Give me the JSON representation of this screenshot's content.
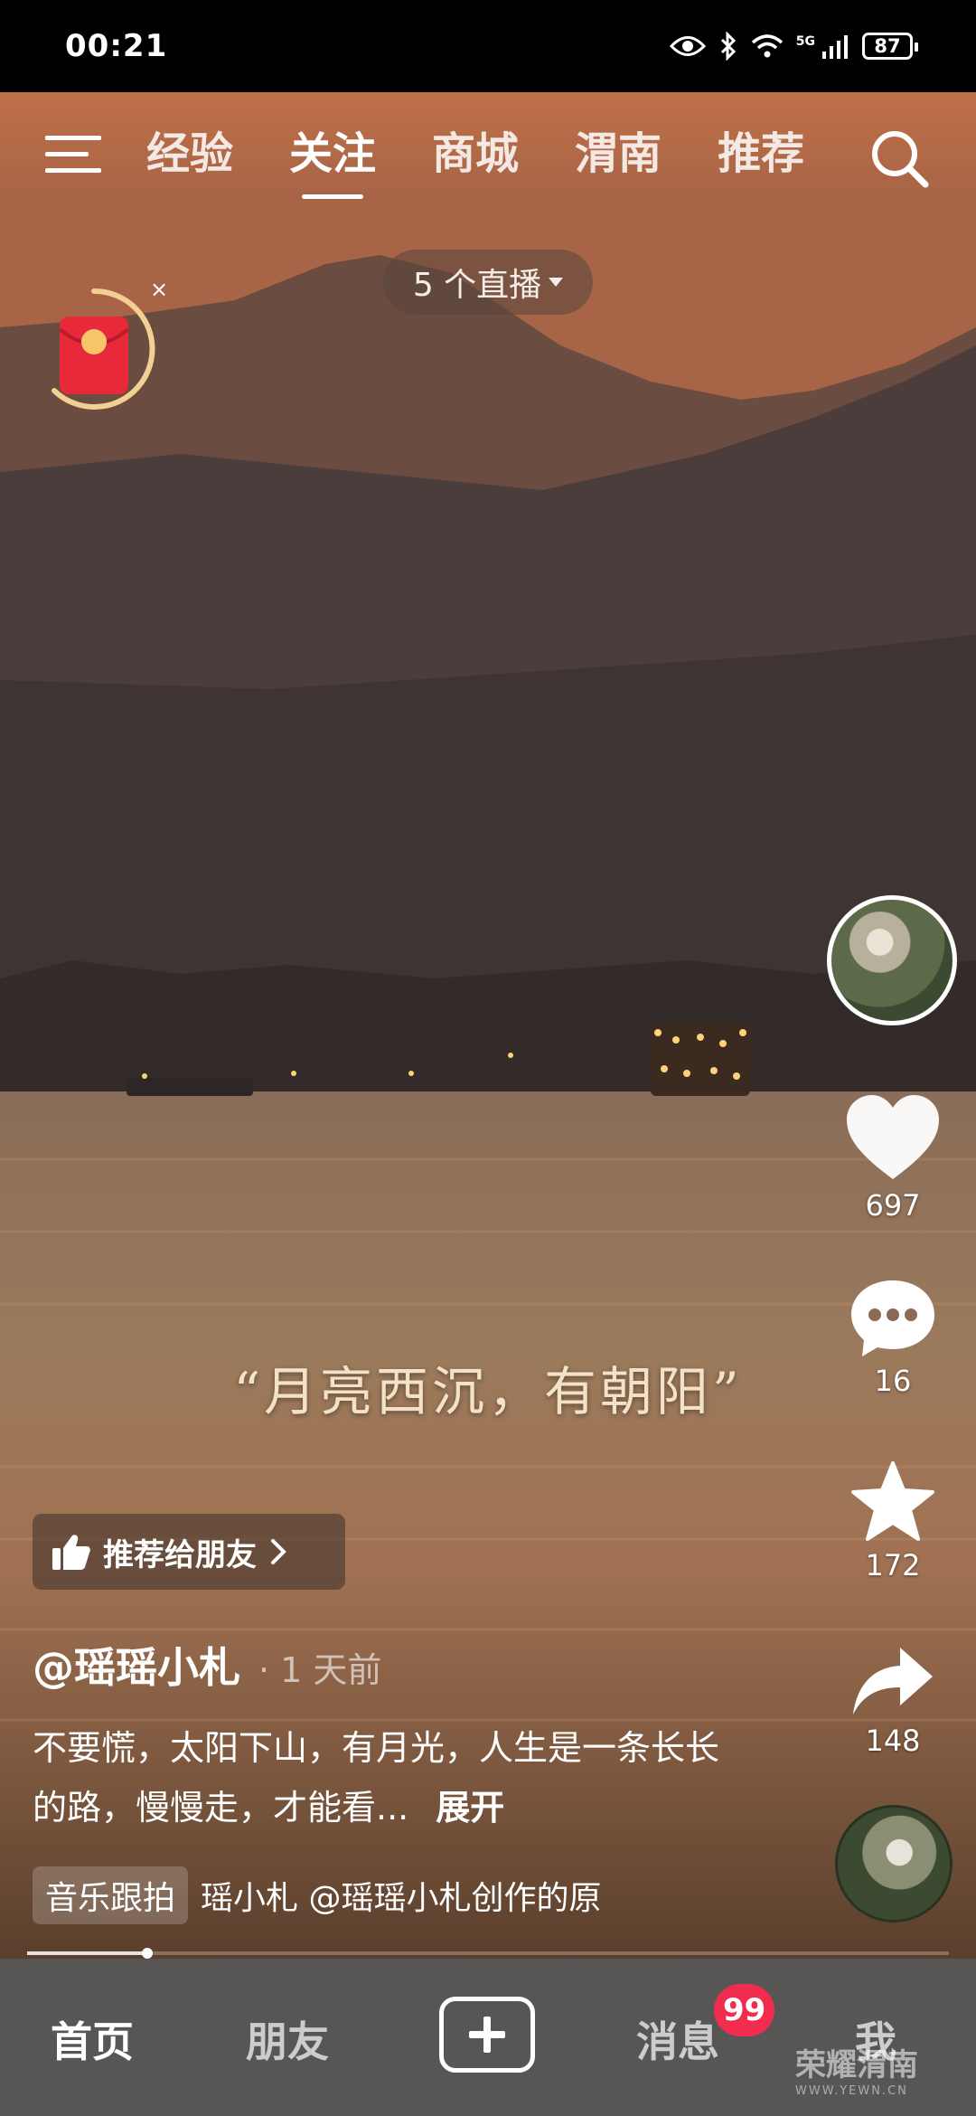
{
  "status_bar": {
    "time": "00:21",
    "network": "5G",
    "battery": "87"
  },
  "top_nav": {
    "tabs": [
      {
        "label": "经验",
        "active": false
      },
      {
        "label": "关注",
        "active": true
      },
      {
        "label": "商城",
        "active": false
      },
      {
        "label": "渭南",
        "active": false
      },
      {
        "label": "推荐",
        "active": false
      }
    ]
  },
  "live": {
    "label": "5 个直播"
  },
  "red_packet": {
    "close": "×",
    "symbol": "¥"
  },
  "video": {
    "caption": "“月亮西沉，有朝阳”"
  },
  "actions": {
    "likes": "697",
    "comments": "16",
    "favorites": "172",
    "shares": "148"
  },
  "recommend": {
    "label": "推荐给朋友"
  },
  "post": {
    "author": "@瑶瑶小札",
    "time_ago": "· 1 天前",
    "description": "不要慌，太阳下山，有月光，人生是一条长长的路，慢慢走，才能看...",
    "expand": "展开"
  },
  "music": {
    "tag": "音乐跟拍",
    "text": "瑶小札    @瑶瑶小札创作的原"
  },
  "progress": {
    "fraction": 0.13
  },
  "bottom_nav": {
    "home": "首页",
    "friends": "朋友",
    "messages": "消息",
    "messages_badge": "99",
    "me": "我"
  },
  "watermark": {
    "main": "荣耀渭南",
    "sub": "WWW.YEWN.CN"
  },
  "colors": {
    "badge": "#f02c4f",
    "nav_bg": "#585555"
  }
}
